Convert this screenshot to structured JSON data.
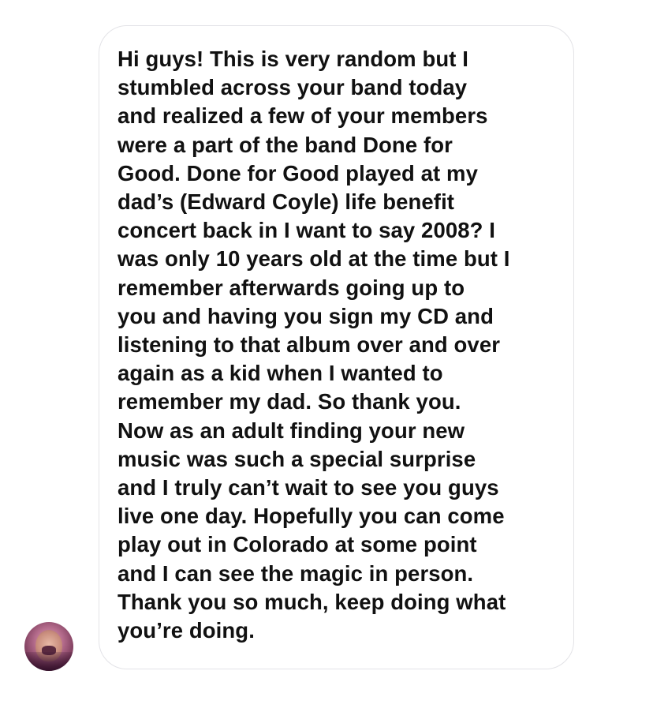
{
  "message": {
    "text": "Hi guys! This is very random but I\nstumbled across your band today\nand realized a few of your members\nwere a part of the band Done for\nGood. Done for Good played at my\ndad’s (Edward Coyle) life benefit\nconcert back in I want to say 2008? I\nwas only 10 years old at the time but I\nremember afterwards going up to\nyou and having you sign my CD and\nlistening to that album over and over\nagain as a kid when I wanted to\nremember my dad. So thank you.\nNow as an adult finding your new\nmusic was such a special surprise\nand I truly can’t wait to see you guys\nlive one day. Hopefully you can come\nplay out in Colorado at some point\nand I can see the magic in person.\nThank you so much, keep doing what\nyou’re doing."
  },
  "avatar": {
    "icon": "user-avatar-photo"
  },
  "colors": {
    "bubble_border": "#e3e3e7",
    "text": "#111111",
    "background": "#ffffff"
  }
}
